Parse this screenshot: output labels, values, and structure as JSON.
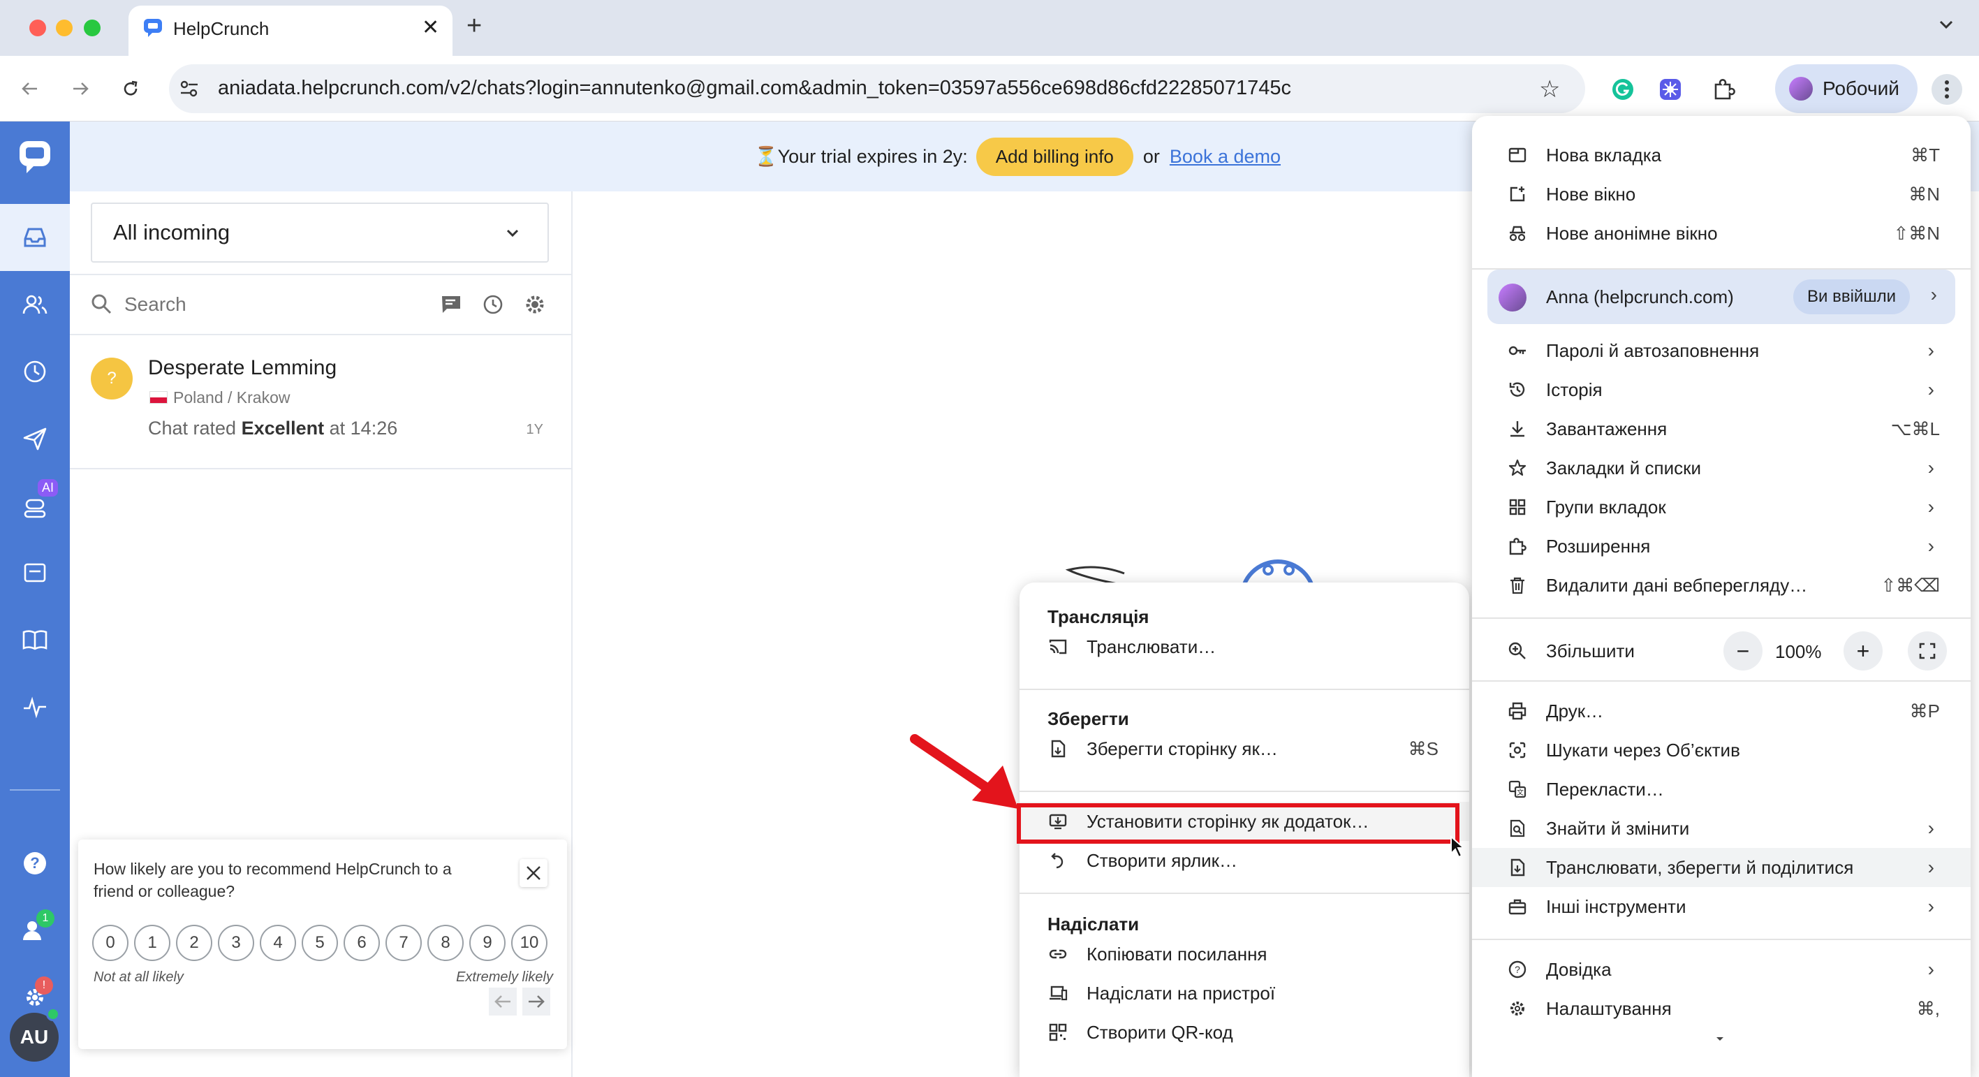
{
  "browser": {
    "tab_title": "HelpCrunch",
    "new_tab_symbol": "+",
    "url": "aniadata.helpcrunch.com/v2/chats?login=annutenko@gmail.com&admin_token=03597a556ce698d86cfd22285071745c",
    "profile_label": "Робочий"
  },
  "banner": {
    "trial_text": "Your trial expires in 2y:",
    "hourglass": "⏳",
    "billing_button": "Add billing info",
    "or_text": "or",
    "demo_link": "Book a demo"
  },
  "chat_list": {
    "filter_label": "All incoming",
    "search_placeholder": "Search",
    "chats": [
      {
        "avatar": "?",
        "name": "Desperate Lemming",
        "location": "Poland / Krakow",
        "preview_prefix": "Chat rated ",
        "preview_bold": "Excellent",
        "preview_suffix": " at 14:26",
        "age": "1Y"
      }
    ]
  },
  "sidebar": {
    "ai_badge": "AI",
    "users_badge": "1",
    "settings_badge": "!",
    "avatar_initials": "AU"
  },
  "survey": {
    "question": "How likely are you to recommend HelpCrunch to a friend or colleague?",
    "scale": [
      "0",
      "1",
      "2",
      "3",
      "4",
      "5",
      "6",
      "7",
      "8",
      "9",
      "10"
    ],
    "low_label": "Not at all likely",
    "high_label": "Extremely likely"
  },
  "chrome_menu": {
    "new_tab": {
      "label": "Нова вкладка",
      "shortcut": "⌘T"
    },
    "new_window": {
      "label": "Нове вікно",
      "shortcut": "⌘N"
    },
    "incognito": {
      "label": "Нове анонімне вікно",
      "shortcut": "⇧⌘N"
    },
    "profile": {
      "label": "Anna (helpcrunch.com)",
      "badge": "Ви ввійшли"
    },
    "passwords": "Паролі й автозаповнення",
    "history": "Історія",
    "downloads": {
      "label": "Завантаження",
      "shortcut": "⌥⌘L"
    },
    "bookmarks": "Закладки й списки",
    "tab_groups": "Групи вкладок",
    "extensions": "Розширення",
    "clear_data": {
      "label": "Видалити дані вебперегляду…",
      "shortcut": "⇧⌘⌫"
    },
    "zoom": {
      "label": "Збільшити",
      "minus": "−",
      "value": "100%",
      "plus": "+"
    },
    "print": {
      "label": "Друк…",
      "shortcut": "⌘P"
    },
    "lens": "Шукати через Об’єктив",
    "translate": "Перекласти…",
    "find": "Знайти й змінити",
    "cast_save_share": "Транслювати, зберегти й поділитися",
    "more_tools": "Інші інструменти",
    "help": "Довідка",
    "settings": {
      "label": "Налаштування",
      "shortcut": "⌘,"
    }
  },
  "submenu": {
    "cast_header": "Трансляція",
    "cast": "Транслювати…",
    "save_header": "Зберегти",
    "save_page": {
      "label": "Зберегти сторінку як…",
      "shortcut": "⌘S"
    },
    "install_app": "Установити сторінку як додаток…",
    "create_shortcut": "Створити ярлик…",
    "send_header": "Надіслати",
    "copy_link": "Копіювати посилання",
    "send_devices": "Надіслати на пристрої",
    "qr_code": "Створити QR-код"
  },
  "colors": {
    "accent": "#4a7ad4",
    "highlight_box": "#e3141c",
    "billing_button": "#f7c948"
  }
}
